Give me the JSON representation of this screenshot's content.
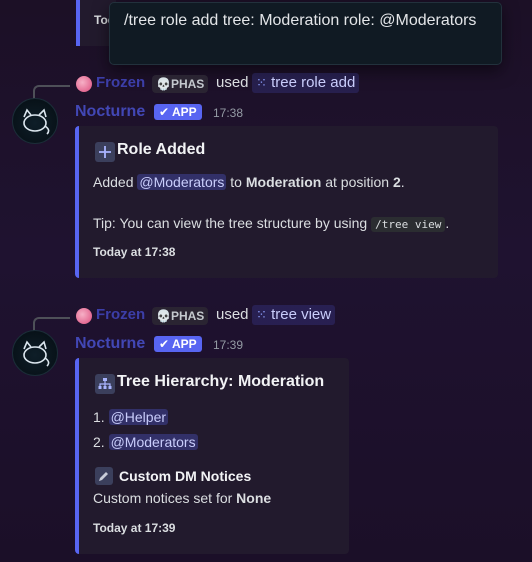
{
  "tooltip": {
    "text": "/tree role add tree: Moderation role: @Moderators"
  },
  "top_embed": {
    "footer": "Toda"
  },
  "messages": [
    {
      "ref_user": "Frozen",
      "ref_tag": "PHAS",
      "used": "used",
      "command": "tree role add",
      "author": "Nocturne",
      "badge": "APP",
      "time": "17:38",
      "embed": {
        "title": "Role Added",
        "line1_a": "Added ",
        "mention": "@Moderators",
        "line1_b": " to ",
        "target": "Moderation",
        "line1_c": " at position ",
        "position": "2",
        "line1_d": ".",
        "tip_a": "Tip: You can view the tree structure by using ",
        "tip_code": "/tree view",
        "tip_b": ".",
        "footer": "Today at 17:38"
      }
    },
    {
      "ref_user": "Frozen",
      "ref_tag": "PHAS",
      "used": "used",
      "command": "tree view",
      "author": "Nocturne",
      "badge": "APP",
      "time": "17:39",
      "embed": {
        "title": "Tree Hierarchy: Moderation",
        "items": [
          {
            "num": "1.",
            "role": "@Helper"
          },
          {
            "num": "2.",
            "role": "@Moderators"
          }
        ],
        "section_title": "Custom DM Notices",
        "section_text_a": "Custom notices set for ",
        "section_text_b": "None",
        "footer": "Today at 17:39"
      }
    }
  ],
  "colors": {
    "accent": "#5865f2",
    "background": "#1f1230",
    "embed": "#221a2d"
  },
  "icons": {
    "plus": "plus-icon",
    "hierarchy": "hierarchy-icon",
    "pencil": "pencil-icon",
    "skull": "skull-icon",
    "command": "command-icon",
    "check": "check-icon"
  }
}
